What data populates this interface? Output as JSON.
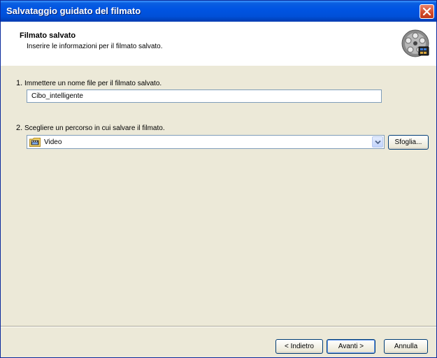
{
  "window": {
    "title": "Salvataggio guidato del filmato"
  },
  "header": {
    "title": "Filmato salvato",
    "subtitle": "Inserire le informazioni per il filmato salvato.",
    "icon": "film-reel-icon"
  },
  "step1": {
    "number": "1.",
    "label": "Immettere un nome file per il filmato salvato.",
    "filename_value": "Cibo_intelligente"
  },
  "step2": {
    "number": "2.",
    "label": "Scegliere un percorso in cui salvare il filmato.",
    "location_value": "Video",
    "location_icon": "folder-video-icon",
    "browse_label": "Sfoglia..."
  },
  "buttons": {
    "back": "< Indietro",
    "next": "Avanti >",
    "cancel": "Annulla"
  },
  "colors": {
    "titlebar": "#0054e3",
    "dialog_bg": "#ece9d8",
    "close_red": "#d14a2a"
  }
}
